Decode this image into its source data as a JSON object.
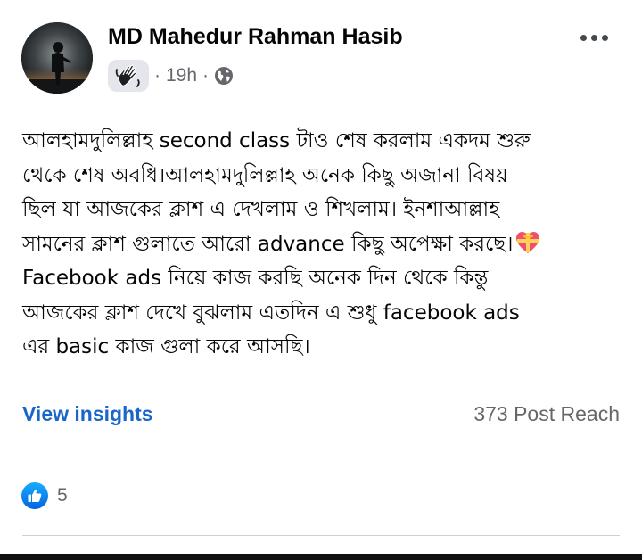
{
  "post": {
    "author": "MD Mahedur Rahman Hasib",
    "time": "19h",
    "separator": "·",
    "audience_icon": "globe-icon",
    "badge_icon": "waving-hand-icon",
    "text_lines": [
      "আলহামদুলিল্লাহ second class টাও শেষ করলাম একদম শুরু",
      "থেকে শেষ অবধি।আলহামদুলিল্লাহ অনেক কিছু অজানা বিষয়",
      "ছিল যা আজকের ক্লাশ এ দেখলাম ও শিখলাম। ইনশাআল্লাহ",
      "সামনের ক্লাশ গুলাতে আরো advance কিছু অপেক্ষা করছে।",
      "Facebook ads নিয়ে কাজ করছি অনেক দিন থেকে কিন্তু",
      "আজকের ক্লাশ দেখে বুঝলাম এতদিন এ শুধু facebook ads",
      "এর basic কাজ গুলা করে আসছি।"
    ],
    "emoji_after_line_4": "heart-with-ribbon-icon"
  },
  "insights": {
    "link_label": "View insights",
    "post_reach": "373 Post Reach"
  },
  "reactions": {
    "icon": "like-icon",
    "count": "5"
  },
  "colors": {
    "link": "#1a66c9",
    "secondary_text": "#65676b",
    "like_blue": "#0866ff"
  }
}
